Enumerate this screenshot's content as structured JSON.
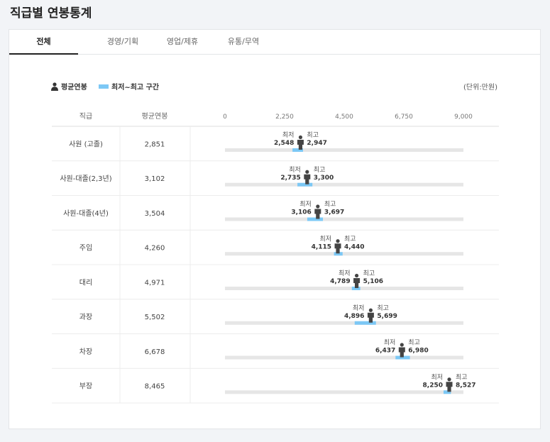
{
  "page": {
    "title": "직급별 연봉통계"
  },
  "tabs": [
    {
      "label": "전체",
      "active": true
    },
    {
      "label": "경영/기획",
      "active": false
    },
    {
      "label": "영업/제휴",
      "active": false
    },
    {
      "label": "유통/무역",
      "active": false
    }
  ],
  "legend": {
    "avg_label": "평균연봉",
    "range_label": "최저~최고 구간",
    "unit": "(단위:만원)"
  },
  "table": {
    "col_rank": "직급",
    "col_avg": "평균연봉"
  },
  "labels": {
    "min": "최저",
    "max": "최고"
  },
  "colors": {
    "bar_bg": "#e6e6e6",
    "range": "#7cc8f5",
    "person": "#444444",
    "grid": "#e8e8e8"
  },
  "chart_data": {
    "type": "bar",
    "title": "",
    "xlabel": "",
    "ylabel": "",
    "xlim": [
      0,
      9000
    ],
    "x_ticks": [
      "0",
      "2,250",
      "4,500",
      "6,750",
      "9,000"
    ],
    "categories": [
      "사원 (고졸)",
      "사원-대졸(2,3년)",
      "사원-대졸(4년)",
      "주임",
      "대리",
      "과장",
      "차장",
      "부장"
    ],
    "series": [
      {
        "name": "평균연봉",
        "values": [
          2851,
          3102,
          3504,
          4260,
          4971,
          5502,
          6678,
          8465
        ]
      },
      {
        "name": "최저",
        "values": [
          2548,
          2735,
          3106,
          4115,
          4789,
          4896,
          6437,
          8250
        ]
      },
      {
        "name": "최고",
        "values": [
          2947,
          3300,
          3697,
          4440,
          5106,
          5699,
          6980,
          8527
        ]
      }
    ],
    "avg_text": [
      "2,851",
      "3,102",
      "3,504",
      "4,260",
      "4,971",
      "5,502",
      "6,678",
      "8,465"
    ],
    "min_text": [
      "2,548",
      "2,735",
      "3,106",
      "4,115",
      "4,789",
      "4,896",
      "6,437",
      "8,250"
    ],
    "max_text": [
      "2,947",
      "3,300",
      "3,697",
      "4,440",
      "5,106",
      "5,699",
      "6,980",
      "8,527"
    ]
  }
}
